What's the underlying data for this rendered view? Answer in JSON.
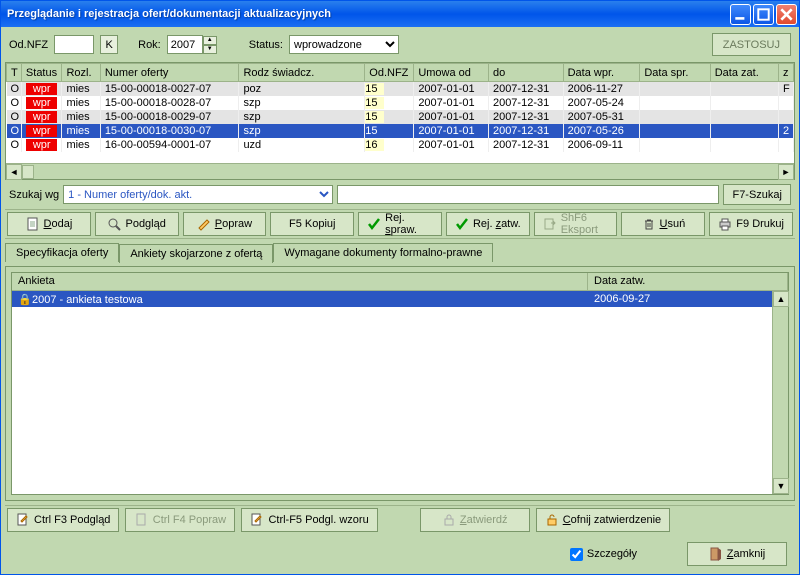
{
  "title": "Przeglądanie i rejestracja ofert/dokumentacji aktualizacyjnych",
  "filters": {
    "odnfz_label": "Od.NFZ",
    "odnfz_btn": "K",
    "rok_label": "Rok:",
    "rok_value": "2007",
    "status_label": "Status:",
    "status_value": "wprowadzone",
    "apply_btn": "ZASTOSUJ"
  },
  "grid": {
    "cols": [
      "T",
      "Status",
      "Rozl.",
      "Numer oferty",
      "Rodz świadcz.",
      "Od.NFZ",
      "Umowa od",
      "do",
      "Data wpr.",
      "Data spr.",
      "Data zat.",
      "z"
    ],
    "rows": [
      {
        "t": "O",
        "status": "wpr",
        "rozl": "mies",
        "num": "15-00-00018-0027-07",
        "rodz": "poz",
        "odnfz": "15",
        "od": "2007-01-01",
        "do": "2007-12-31",
        "wpr": "2006-11-27",
        "cls": "gray",
        "z": "F"
      },
      {
        "t": "O",
        "status": "wpr",
        "rozl": "mies",
        "num": "15-00-00018-0028-07",
        "rodz": "szp",
        "odnfz": "15",
        "od": "2007-01-01",
        "do": "2007-12-31",
        "wpr": "2007-05-24",
        "cls": ""
      },
      {
        "t": "O",
        "status": "wpr",
        "rozl": "mies",
        "num": "15-00-00018-0029-07",
        "rodz": "szp",
        "odnfz": "15",
        "od": "2007-01-01",
        "do": "2007-12-31",
        "wpr": "2007-05-31",
        "cls": "gray"
      },
      {
        "t": "O",
        "status": "wpr",
        "rozl": "mies",
        "num": "15-00-00018-0030-07",
        "rodz": "szp",
        "odnfz": "15",
        "od": "2007-01-01",
        "do": "2007-12-31",
        "wpr": "2007-05-26",
        "cls": "sel",
        "z": "2"
      },
      {
        "t": "O",
        "status": "wpr",
        "rozl": "mies",
        "num": "16-00-00594-0001-07",
        "rodz": "uzd",
        "odnfz": "16",
        "od": "2007-01-01",
        "do": "2007-12-31",
        "wpr": "2006-09-11",
        "cls": ""
      }
    ]
  },
  "search": {
    "label": "Szukaj wg",
    "mode": "1 - Numer oferty/dok. akt.",
    "btn": "F7-Szukaj"
  },
  "actions": {
    "dodaj": "Dodaj",
    "podglad": "Podgląd",
    "popraw": "Popraw",
    "kopiuj": "F5 Kopiuj",
    "rejspraw": "Rej. spraw.",
    "rejzatw": "Rej. zatw.",
    "eksport": "ShF6 Eksport",
    "usun": "Usuń",
    "drukuj": "F9 Drukuj"
  },
  "tabs": {
    "t1": "Specyfikacja oferty",
    "t2": "Ankiety skojarzone z ofertą",
    "t3": "Wymagane dokumenty formalno-prawne"
  },
  "detail": {
    "col1": "Ankieta",
    "col2": "Data zatw.",
    "row_name": "2007 - ankieta testowa",
    "row_date": "2006-09-27"
  },
  "detail_actions": {
    "podglad": "Ctrl F3 Podgląd",
    "popraw": "Ctrl F4 Popraw",
    "wzor": "Ctrl-F5 Podgl. wzoru",
    "zatwierdz": "Zatwierdź",
    "cofnij": "Cofnij zatwierdzenie"
  },
  "bottom": {
    "szczegoly": "Szczegóły",
    "zamknij": "Zamknij"
  }
}
